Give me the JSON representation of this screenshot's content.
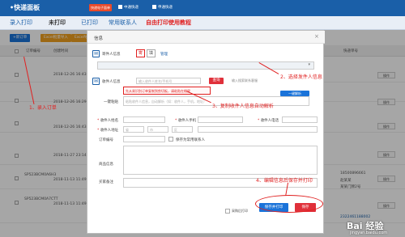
{
  "app": {
    "brand": "•快递面板",
    "badge": "快递电子面单",
    "top_checks": [
      "中通快递",
      "申通快递"
    ]
  },
  "tabs": {
    "items": [
      "录入打印",
      "未打印",
      "已打印",
      "常用联系人"
    ],
    "tutorial": "自由打印使用教程"
  },
  "toolbar": {
    "add_order": "+新订单",
    "excel_import": "Excel批量导入",
    "excel_export": "Excel导出"
  },
  "table": {
    "headers": [
      "订单编号",
      "创建时间",
      "快递单号"
    ],
    "rows": [
      {
        "order": "",
        "time": "2018-12-26 16:43:1",
        "op": "操作"
      },
      {
        "order": "",
        "time": "2018-12-26 16:29:24",
        "op": "操作"
      },
      {
        "order": "",
        "time": "2018-12-26 16:43:2",
        "op": "操作"
      },
      {
        "order": "",
        "time": "2018-11-27 23:14",
        "op": "操作"
      },
      {
        "order": "SP523BCM0A6H3",
        "time": "2018-11-13 11:49:33",
        "op": "操作"
      },
      {
        "order": "SP523BCM0A7CTT",
        "time": "2018-11-13 11:49:56",
        "op": "操作"
      }
    ],
    "right_col": [
      "18500896661",
      "赵某某",
      "某某门牌2号",
      "代收金额：",
      "2322461188002"
    ],
    "row_meta": [
      "代收金额：",
      "增加11.13"
    ]
  },
  "modal": {
    "title": "信息",
    "sender": {
      "label": "寄件人信息",
      "icons": [
        "寄",
        "填"
      ],
      "manage": "管理",
      "select_placeholder": ""
    },
    "receiver": {
      "label": "收件人信息",
      "name_placeholder": "输入收件人姓名/手机号",
      "search_btn": "查询",
      "hint": "输入搜索联系客服",
      "paste_label": "一键粘贴",
      "red_hint": "先从易识别订单复制到剪切板，请粘贴在框里",
      "paste_placeholder": "粘贴收件人信息，自动解析（如：收件人，手机，地址）",
      "parse_btn": "一键解析"
    },
    "fields": {
      "name": "收件人姓名",
      "mobile": "收件人手机",
      "phone": "收件人电话",
      "address": "收件人地址",
      "province": "省",
      "city": "市",
      "district": "区",
      "order_no": "订单编号",
      "save_contact": "保存为常用联系人",
      "goods": "商品信息",
      "remark": "买家备注"
    },
    "footer": {
      "continue_label": "采购后打印",
      "save_print_btn": "保存并打印",
      "save_btn": "保存"
    }
  },
  "annotations": {
    "a1": "1、录入订单",
    "a2": "2、选择发件人信息",
    "a3": "3、复制收件人信息自动解析",
    "a4": "4、编辑信息后保存并打印"
  },
  "watermark": {
    "brand": "Bai 经验",
    "url": "jingyan.baidu.com"
  },
  "colors": {
    "primary": "#1a5fa8",
    "accent_red": "#e02020",
    "badge_orange": "#e94a2a",
    "btn_blue": "#1a73d9"
  }
}
